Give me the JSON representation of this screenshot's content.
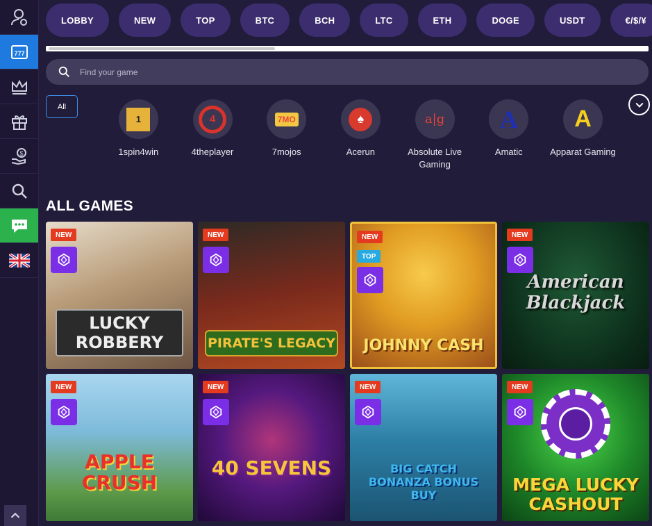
{
  "categories": [
    "LOBBY",
    "NEW",
    "TOP",
    "BTC",
    "BCH",
    "LTC",
    "ETH",
    "DOGE",
    "USDT",
    "€/$/¥"
  ],
  "search": {
    "placeholder": "Find your game"
  },
  "filter": {
    "all_label": "All"
  },
  "providers": [
    {
      "name": "1spin4win",
      "logo_text": "1"
    },
    {
      "name": "4theplayer",
      "logo_text": "4"
    },
    {
      "name": "7mojos",
      "logo_text": "7MO"
    },
    {
      "name": "Acerun",
      "logo_text": "♠"
    },
    {
      "name": "Absolute Live Gaming",
      "logo_text": "a|g"
    },
    {
      "name": "Amatic",
      "logo_text": "A"
    },
    {
      "name": "Apparat Gaming",
      "logo_text": "A"
    }
  ],
  "section_title": "ALL GAMES",
  "badges": {
    "new": "NEW",
    "top": "TOP"
  },
  "games": [
    {
      "title": "LUCKY ROBBERY",
      "top": false,
      "bg": "#c9b99a",
      "title_color": "#e9e9e9"
    },
    {
      "title": "PIRATE'S LEGACY",
      "top": false,
      "bg": "#5b2a1f",
      "title_color": "#f4c23a"
    },
    {
      "title": "JOHNNY CASH",
      "top": true,
      "bg": "#d88b1e",
      "title_color": "#fbe26a"
    },
    {
      "title": "American Blackjack",
      "top": false,
      "bg": "#0f3a22",
      "title_color": "#d8d8d8"
    },
    {
      "title": "APPLE CRUSH",
      "top": false,
      "bg": "#6fb2d8",
      "title_color": "#e8312d"
    },
    {
      "title": "40 SEVENS",
      "top": false,
      "bg": "#3a0f5c",
      "title_color": "#f6c63a"
    },
    {
      "title": "BIG CATCH BONANZA BONUS BUY",
      "top": false,
      "bg": "#2f7fa8",
      "title_color": "#3fb8ef"
    },
    {
      "title": "MEGA LUCKY CASHOUT",
      "top": false,
      "bg": "#1f7e2a",
      "title_color": "#f9d63a"
    }
  ],
  "colors": {
    "sidebar_active": "#1f7ae0",
    "chat": "#2bb24c",
    "category_pill": "#3b2d6e",
    "badge_new": "#e43a1f",
    "badge_top": "#27a9e1",
    "gem": "#7a2ee6"
  }
}
